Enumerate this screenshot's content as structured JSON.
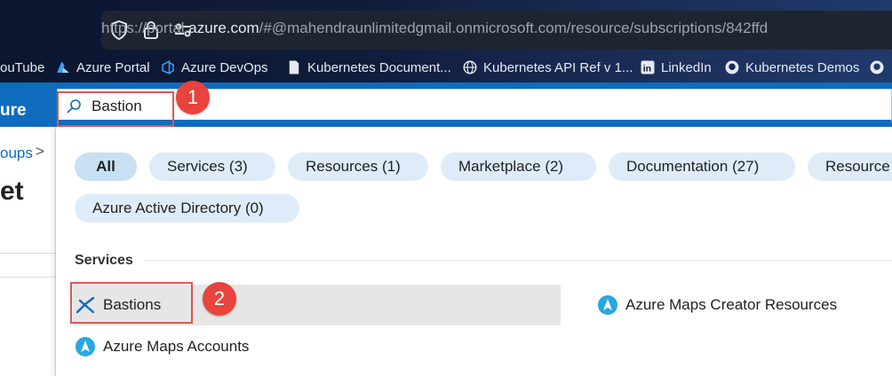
{
  "browser": {
    "url_prefix": "https://portal.",
    "url_domain": "azure.com",
    "url_rest": "/#@mahendraunlimitedgmail.onmicrosoft.com/resource/subscriptions/842ffd",
    "bookmarks": [
      {
        "label": "ouTube",
        "icon": "youtube-icon"
      },
      {
        "label": "Azure Portal",
        "icon": "azure-icon"
      },
      {
        "label": "Azure DevOps",
        "icon": "azure-devops-icon"
      },
      {
        "label": "Kubernetes Document...",
        "icon": "document-icon"
      },
      {
        "label": "Kubernetes API Ref v 1...",
        "icon": "globe-icon"
      },
      {
        "label": "LinkedIn",
        "icon": "linkedin-icon"
      },
      {
        "label": "Kubernetes Demos",
        "icon": "github-icon"
      }
    ]
  },
  "portal": {
    "brand": "ure",
    "search_value": "Bastion",
    "breadcrumb": "oups",
    "page_title": "et"
  },
  "filters": [
    {
      "label": "All",
      "active": true
    },
    {
      "label": "Services  (3)"
    },
    {
      "label": "Resources  (1)"
    },
    {
      "label": "Marketplace  (2)"
    },
    {
      "label": "Documentation  (27)"
    },
    {
      "label": "Resource"
    },
    {
      "label": "Azure Active Directory  (0)"
    }
  ],
  "services_section": {
    "label": "Services",
    "results": [
      {
        "label": "Bastions",
        "icon": "bastion-icon"
      },
      {
        "label": "Azure Maps Creator Resources",
        "icon": "azure-maps-icon"
      },
      {
        "label": "Azure Maps Accounts",
        "icon": "azure-maps-icon"
      }
    ]
  },
  "annotations": [
    "1",
    "2"
  ],
  "colors": {
    "accent": "#0f6cbd",
    "pill": "#deecf9",
    "highlight_box": "#e05555",
    "badge": "#e8433d"
  }
}
